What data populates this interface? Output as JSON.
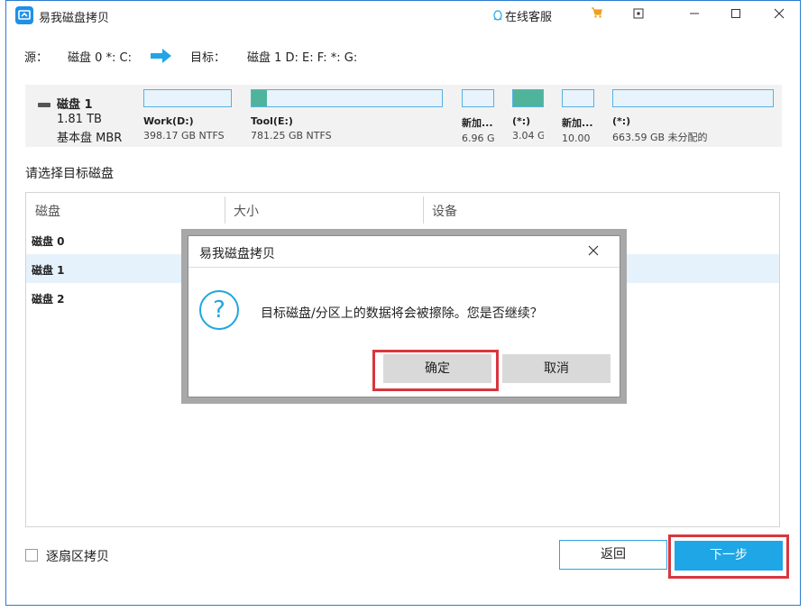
{
  "window": {
    "title": "易我磁盘拷贝",
    "service_label": "在线客服"
  },
  "source_target": {
    "source_label": "源：",
    "source_value": "磁盘 0 *: C:",
    "target_label": "目标：",
    "target_value": "磁盘 1 D: E: F: *: G:"
  },
  "disk_summary": {
    "name": "磁盘 1",
    "size": "1.81 TB",
    "type": "基本盘 MBR",
    "partitions": [
      {
        "label": "Work(D:)",
        "size": "398.17 GB NTFS",
        "used_fraction": 0.0
      },
      {
        "label": "Tool(E:)",
        "size": "781.25 GB NTFS",
        "used_fraction": 0.08
      },
      {
        "label": "新加...",
        "size": "6.96 G...",
        "used_fraction": 0.0
      },
      {
        "label": "(*:)",
        "size": "3.04 G...",
        "used_fraction": 1.0
      },
      {
        "label": "新加...",
        "size": "10.00 ...",
        "used_fraction": 0.0
      },
      {
        "label": "(*:)",
        "size": "663.59 GB 未分配的",
        "used_fraction": 0.0
      }
    ]
  },
  "section_label": "请选择目标磁盘",
  "table": {
    "headers": [
      "磁盘",
      "大小",
      "设备"
    ],
    "rows": [
      {
        "disk": "磁盘 0"
      },
      {
        "disk": "磁盘 1"
      },
      {
        "disk": "磁盘 2"
      }
    ]
  },
  "dialog": {
    "title": "易我磁盘拷贝",
    "message": "目标磁盘/分区上的数据将会被擦除。您是否继续？",
    "confirm_label": "确定",
    "cancel_label": "取消"
  },
  "footer": {
    "sector_copy_label": "逐扇区拷贝",
    "back_label": "返回",
    "next_label": "下一步"
  },
  "colors": {
    "accent": "#1fa6e6",
    "highlight": "#d9363e",
    "partition_fill": "#4fb49a",
    "selected_row": "#e6f2fb"
  }
}
